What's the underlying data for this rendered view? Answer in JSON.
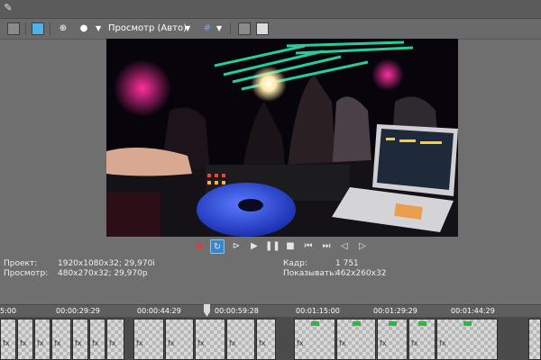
{
  "toolbar": {
    "preview_mode_label": "Просмотр (Авто)",
    "icons": [
      "properties-icon",
      "monitor-icon",
      "split-icon",
      "circle-icon",
      "grid-icon",
      "copy-icon",
      "save-icon"
    ]
  },
  "info": {
    "project_label": "Проект:",
    "project_value": "1920x1080x32; 29,970i",
    "preview_label": "Просмотр:",
    "preview_value": "480x270x32; 29,970p",
    "frame_label": "Кадр:",
    "frame_value": "1 751",
    "display_label": "Показывать:",
    "display_value": "462x260x32"
  },
  "ruler": {
    "ticks": [
      "5:00",
      "00:00:29:29",
      "00:00:44:29",
      "00:00:59:28",
      "00:01:15:00",
      "00:01:29:29",
      "00:01:44:29"
    ]
  },
  "colors": {
    "accent": "#3a86c8",
    "record": "#e23a3a",
    "background": "#6f6f6f",
    "clip_tag": "#2bbb3c"
  }
}
